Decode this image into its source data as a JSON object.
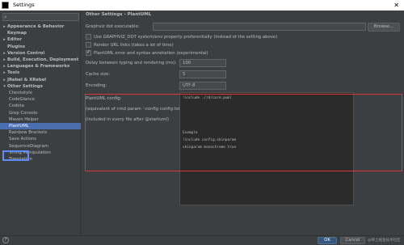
{
  "window": {
    "title": "Settings",
    "close_glyph": "✕"
  },
  "search": {
    "icon": "search-icon"
  },
  "sidebar": {
    "items": [
      {
        "label": "Appearance & Behavior",
        "arrow": "▸",
        "bold": true
      },
      {
        "label": "Keymap",
        "arrow": "",
        "bold": true
      },
      {
        "label": "Editor",
        "arrow": "▸",
        "bold": true
      },
      {
        "label": "Plugins",
        "arrow": "",
        "bold": true
      },
      {
        "label": "Version Control",
        "arrow": "▸",
        "bold": true
      },
      {
        "label": "Build, Execution, Deployment",
        "arrow": "▸",
        "bold": true
      },
      {
        "label": "Languages & Frameworks",
        "arrow": "▸",
        "bold": true
      },
      {
        "label": "Tools",
        "arrow": "▸",
        "bold": true
      },
      {
        "label": "JRebel & XRebel",
        "arrow": "▸",
        "bold": true
      },
      {
        "label": "Other Settings",
        "arrow": "▾",
        "bold": true
      },
      {
        "label": "Checkstyle",
        "arrow": "",
        "bold": false
      },
      {
        "label": "CodeGlance",
        "arrow": "",
        "bold": false
      },
      {
        "label": "Codota",
        "arrow": "",
        "bold": false
      },
      {
        "label": "Grep Console",
        "arrow": "",
        "bold": false
      },
      {
        "label": "Maven Helper",
        "arrow": "",
        "bold": false
      },
      {
        "label": "PlantUML",
        "arrow": "",
        "bold": false
      },
      {
        "label": "Rainbow Brackets",
        "arrow": "",
        "bold": false
      },
      {
        "label": "Save Actions",
        "arrow": "",
        "bold": false
      },
      {
        "label": "SequenceDiagram",
        "arrow": "",
        "bold": false
      },
      {
        "label": "String Manipulation",
        "arrow": "",
        "bold": false
      },
      {
        "label": "Translation",
        "arrow": "",
        "bold": false
      }
    ]
  },
  "main": {
    "breadcrumb": "Other Settings  ›  PlantUML",
    "graphviz_label": "Graphviz dot executable:",
    "browse_label": "Browse...",
    "checkboxes": [
      {
        "label": "Use GRAPHVIZ_DOT system/env property preferentially (instead of the setting above)",
        "checked": false
      },
      {
        "label": "Render URL links (takes a lot of time)",
        "checked": false
      },
      {
        "label": "PlantUML error and syntax annotation (experimental)",
        "checked": true
      }
    ],
    "delay_label": "Delay between typing and rendering (ms):",
    "delay_value": "100",
    "cache_label": "Cache size:",
    "cache_value": "5",
    "encoding_label": "Encoding:",
    "encoding_value": "UTF-8",
    "config_label": "PlantUML config:",
    "config_hint1": "(equivalent of cmd param '-config config.txt')",
    "config_hint2": "(included in every file after @startuml)",
    "config_lines": {
      "l1": "!include  ./rd/core.puml",
      "l2": "Example",
      "l3": "!include config.skinparam",
      "l4": "skinparam monochrome true"
    }
  },
  "buttons": {
    "help": "?",
    "ok": "OK",
    "cancel": "Cancel"
  },
  "watermark": "@稀土掘金技术社区",
  "colors": {
    "selected": "#4b6eaf",
    "annotation_red": "#d9363e",
    "annotation_blue": "#5d8cff",
    "ok_button": "#365880"
  }
}
